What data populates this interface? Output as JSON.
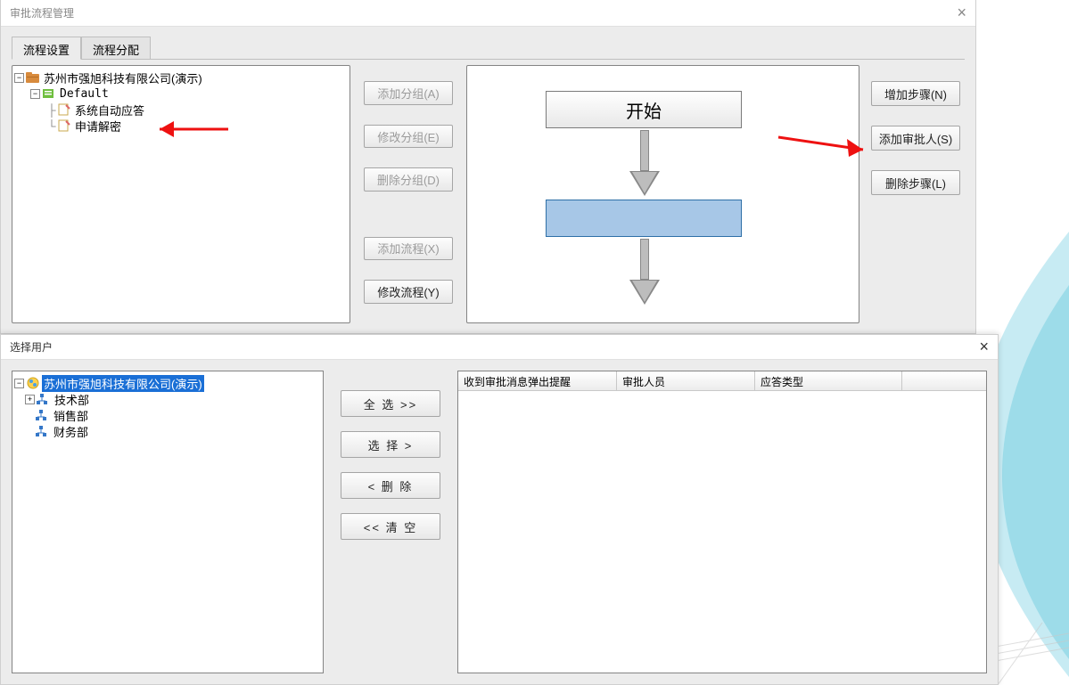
{
  "window1": {
    "title": "审批流程管理",
    "tabs": {
      "active": "流程设置",
      "inactive": "流程分配"
    },
    "tree": {
      "root": "苏州市强旭科技有限公司(演示)",
      "group": "Default",
      "item1": "系统自动应答",
      "item2": "申请解密"
    },
    "buttons": {
      "addGroup": "添加分组(A)",
      "editGroup": "修改分组(E)",
      "delGroup": "删除分组(D)",
      "addFlow": "添加流程(X)",
      "editFlow": "修改流程(Y)"
    },
    "flow": {
      "start": "开始"
    },
    "rightButtons": {
      "addStep": "增加步骤(N)",
      "addApprover": "添加审批人(S)",
      "delStep": "删除步骤(L)"
    }
  },
  "window2": {
    "title": "选择用户",
    "tree": {
      "root": "苏州市强旭科技有限公司(演示)",
      "dept1": "技术部",
      "dept2": "销售部",
      "dept3": "财务部"
    },
    "buttons": {
      "selectAll": "全  选  >>",
      "select": "选  择  >",
      "remove": "<  删  除",
      "clear": "<<  清  空"
    },
    "tableHeaders": {
      "col1": "收到审批消息弹出提醒",
      "col2": "审批人员",
      "col3": "应答类型"
    }
  }
}
